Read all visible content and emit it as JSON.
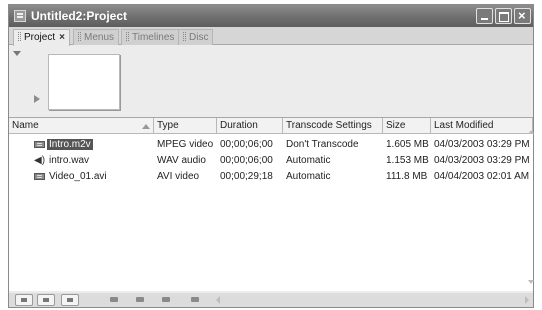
{
  "window": {
    "title": "Untitled2:Project",
    "icon": "project-window-icon",
    "controls": [
      "minimize-icon",
      "maximize-icon",
      "close-icon"
    ]
  },
  "tabs": [
    {
      "label": "Project",
      "active": true,
      "close": "×"
    },
    {
      "label": "Menus",
      "active": false
    },
    {
      "label": "Timelines",
      "active": false
    },
    {
      "label": "Disc",
      "active": false
    }
  ],
  "preview": {
    "toggle_icon": "triangle-down-icon",
    "play_icon": "play-icon"
  },
  "columns": [
    {
      "label": "Name"
    },
    {
      "label": "Type"
    },
    {
      "label": "Duration"
    },
    {
      "label": "Transcode Settings"
    },
    {
      "label": "Size"
    },
    {
      "label": "Last Modified"
    }
  ],
  "sort": {
    "column": "Name",
    "direction": "ascending"
  },
  "rows": [
    {
      "icon": "video-file-icon",
      "name": "Intro.m2v",
      "type": "MPEG video",
      "duration": "00;00;06;00",
      "transcode": "Don't Transcode",
      "size": "1.605 MB",
      "modified": "04/03/2003 03:29 PM",
      "selected": true
    },
    {
      "icon": "audio-file-icon",
      "name": "intro.wav",
      "type": "WAV audio",
      "duration": "00;00;06;00",
      "transcode": "Automatic",
      "size": "1.153 MB",
      "modified": "04/03/2003 03:29 PM",
      "selected": false
    },
    {
      "icon": "video-file-icon",
      "name": "Video_01.avi",
      "type": "AVI video",
      "duration": "00;00;29;18",
      "transcode": "Automatic",
      "size": "111.8 MB",
      "modified": "04/04/2003 02:01 AM",
      "selected": false
    }
  ],
  "bottom_toolbar": [
    "list-view-icon",
    "icon-view-icon",
    "thumbnail-view-icon",
    "new-menu-icon",
    "new-timeline-icon",
    "new-folder-icon",
    "delete-icon"
  ],
  "colors": {
    "titlebar": "#6f6f6f",
    "selection": "#555555",
    "panel": "#ececec"
  }
}
